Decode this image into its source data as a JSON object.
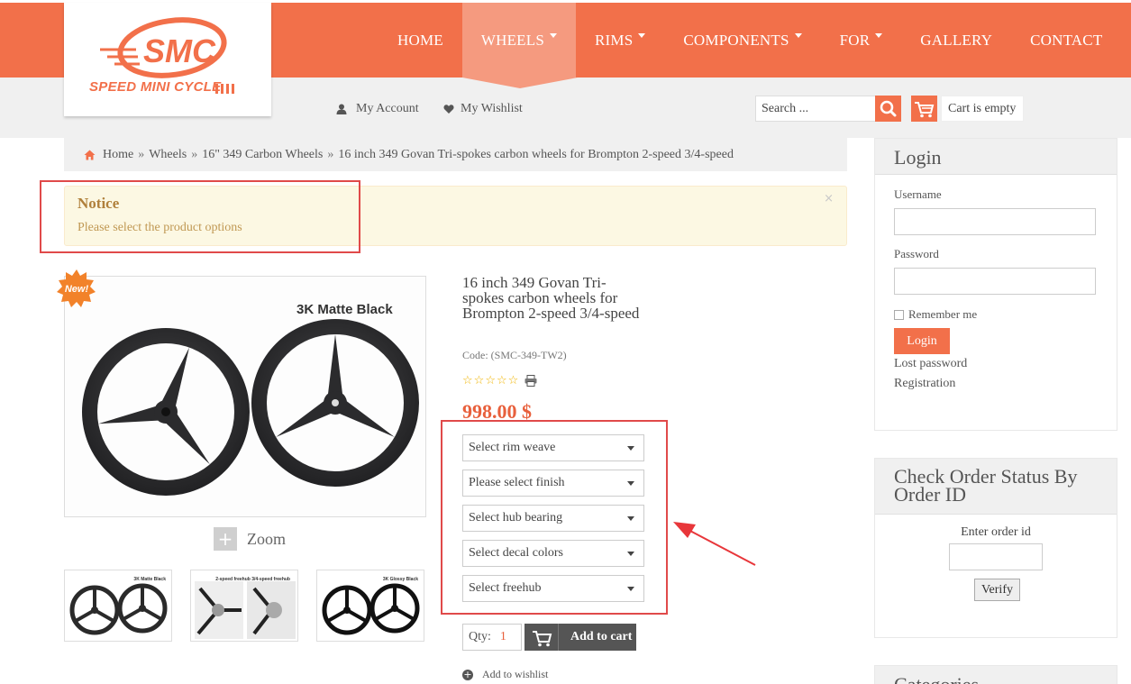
{
  "brand": {
    "logo_abbrev": "SMC",
    "logo_name": "SPEED MINI CYCLE"
  },
  "nav": [
    {
      "label": "HOME",
      "dropdown": false,
      "active": false
    },
    {
      "label": "WHEELS",
      "dropdown": true,
      "active": true
    },
    {
      "label": "RIMS",
      "dropdown": true,
      "active": false
    },
    {
      "label": "COMPONENTS",
      "dropdown": true,
      "active": false
    },
    {
      "label": "FOR",
      "dropdown": true,
      "active": false
    },
    {
      "label": "GALLERY",
      "dropdown": false,
      "active": false
    },
    {
      "label": "CONTACT",
      "dropdown": false,
      "active": false
    }
  ],
  "account": {
    "my_account": "My Account",
    "my_wishlist": "My Wishlist"
  },
  "search": {
    "placeholder": "Search ..."
  },
  "cart": {
    "status": "Cart is empty"
  },
  "breadcrumb": [
    "Home",
    "Wheels",
    "16\" 349 Carbon Wheels",
    "16 inch 349 Govan Tri-spokes carbon wheels for Brompton 2-speed 3/4-speed"
  ],
  "notice": {
    "title": "Notice",
    "message": "Please select the product options",
    "close": "×"
  },
  "product": {
    "badge": "New!",
    "image_caption": "3K Matte Black",
    "zoom_label": "Zoom",
    "thumbnails": [
      {
        "caption": "3K Matte Black"
      },
      {
        "caption": "2-speed freehub   3/4-speed freehub"
      },
      {
        "caption": "3K Glossy Black"
      }
    ],
    "title": "16 inch 349 Govan Tri-spokes carbon wheels for Brompton 2-speed 3/4-speed",
    "code": "Code: (SMC-349-TW2)",
    "rating": 0,
    "rating_max": 5,
    "price": "998.00 $",
    "options": [
      "Select rim weave",
      "Please select finish",
      "Select hub bearing",
      "Select decal colors",
      "Select freehub"
    ],
    "qty_label": "Qty:",
    "qty_value": "1",
    "add_to_cart": "Add to cart",
    "add_to_wishlist": "Add to wishlist"
  },
  "login": {
    "title": "Login",
    "username_label": "Username",
    "password_label": "Password",
    "remember_label": "Remember me",
    "button": "Login",
    "lost_password": "Lost password",
    "registration": "Registration"
  },
  "order_status": {
    "title": "Check Order Status By Order ID",
    "input_label": "Enter order id",
    "verify_button": "Verify"
  },
  "categories": {
    "title": "Categories"
  },
  "colors": {
    "accent": "#f2704a",
    "accent_light": "#f59a7f",
    "price": "#e8603c",
    "highlight_box": "#e04a4a"
  }
}
